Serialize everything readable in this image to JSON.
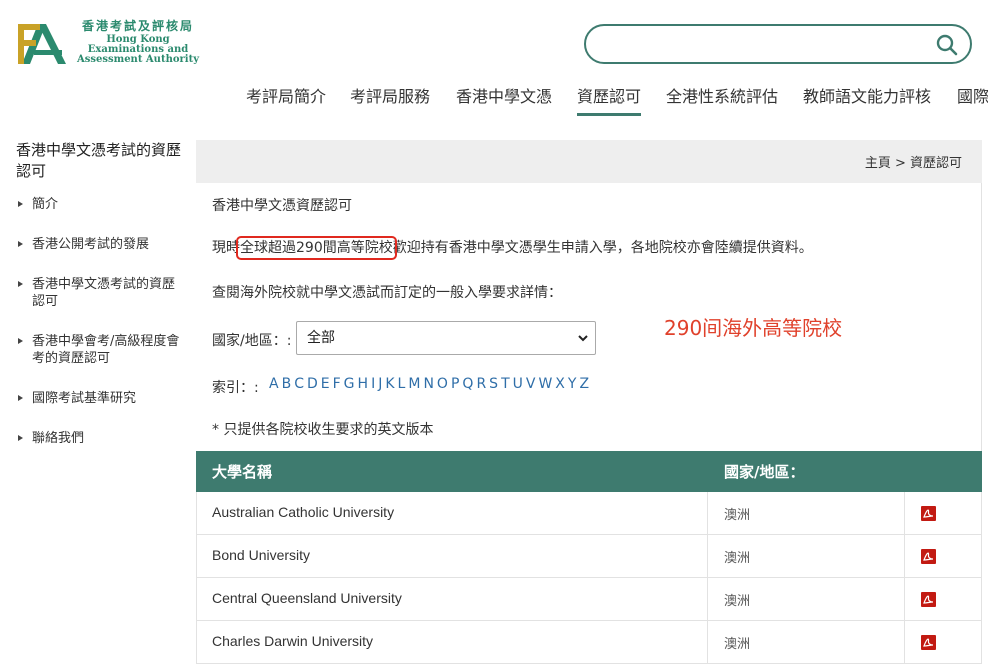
{
  "logo": {
    "cn": "香港考試及評核局",
    "en_lines": [
      "Hong Kong",
      "Examinations and",
      "Assessment Authority"
    ]
  },
  "nav": {
    "items": [
      "考評局簡介",
      "考評局服務",
      "香港中學文憑",
      "資歷認可",
      "全港性系統評估",
      "教師語文能力評核",
      "國際"
    ],
    "active": "資歷認可"
  },
  "sidebar": {
    "title": "香港中學文憑考試的資歷認可",
    "items": [
      "簡介",
      "香港公開考試的發展",
      "香港中學文憑考試的資歷認可",
      "香港中學會考/高級程度會考的資歷認可",
      "國際考試基準研究",
      "聯絡我們"
    ]
  },
  "breadcrumb": "主頁 > 資歷認可",
  "main": {
    "heading": "香港中學文憑資歷認可",
    "intro_prefix": "現時",
    "intro_highlight": "全球超過290間高等院校",
    "intro_suffix": "歡迎持有香港中學文憑學生申請入學，各地院校亦會陸續提供資料。",
    "overseas_note": "查閱海外院校就中學文憑試而訂定的一般入學要求詳情：",
    "country_label": "國家/地區：:",
    "country_selected": "全部",
    "index_label": "索引：:",
    "letters": [
      "A",
      "B",
      "C",
      "D",
      "E",
      "F",
      "G",
      "H",
      "I",
      "J",
      "K",
      "L",
      "M",
      "N",
      "O",
      "P",
      "Q",
      "R",
      "S",
      "T",
      "U",
      "V",
      "W",
      "X",
      "Y",
      "Z"
    ],
    "english_note": "* 只提供各院校收生要求的英文版本"
  },
  "annotation": "290间海外高等院校",
  "table": {
    "headers": [
      "大學名稱",
      "國家/地區："
    ],
    "rows": [
      {
        "name": "Australian Catholic University",
        "country": "澳洲"
      },
      {
        "name": "Bond University",
        "country": "澳洲"
      },
      {
        "name": "Central Queensland University",
        "country": "澳洲"
      },
      {
        "name": "Charles Darwin University",
        "country": "澳洲"
      }
    ]
  },
  "colors": {
    "accent": "#3e7b6f",
    "highlight": "#e0291f",
    "annotation": "#e0412b",
    "pdf": "#c21a12",
    "link": "#2f6ea8"
  }
}
